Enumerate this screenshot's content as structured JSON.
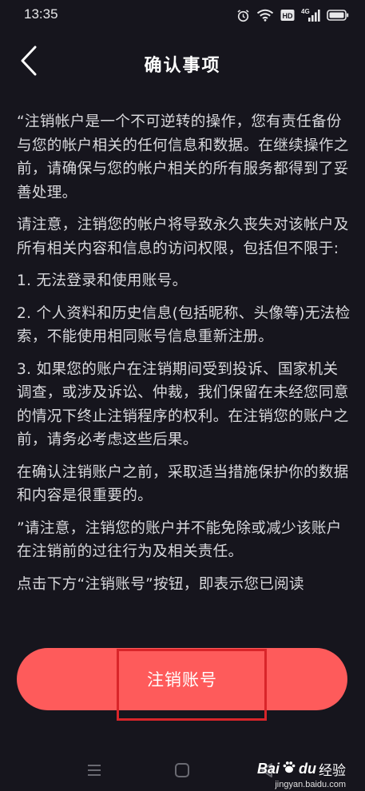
{
  "status_bar": {
    "time": "13:35",
    "icons": [
      "alarm-icon",
      "wifi-icon",
      "hd-icon",
      "signal-4g-icon",
      "battery-icon"
    ],
    "hd_label": "HD",
    "network_label": "4G"
  },
  "header": {
    "title": "确认事项",
    "back_icon": "chevron-left-icon"
  },
  "content": {
    "paragraphs": [
      "“注销帐户是一个不可逆转的操作，您有责任备份与您的帐户相关的任何信息和数据。在继续操作之前，请确保与您的帐户相关的所有服务都得到了妥善处理。",
      "请注意，注销您的帐户将导致永久丧失对该帐户及所有相关内容和信息的访问权限，包括但不限于:",
      "1. 无法登录和使用账号。",
      "2. 个人资料和历史信息(包括昵称、头像等)无法检索，不能使用相同账号信息重新注册。",
      "3. 如果您的账户在注销期间受到投诉、国家机关调查，或涉及诉讼、仲裁，我们保留在未经您同意的情况下终止注销程序的权利。在注销您的账户之前，请务必考虑这些后果。",
      "在确认注销账户之前，采取适当措施保护你的数据和内容是很重要的。",
      "”请注意，注销您的账户并不能免除或减少该账户在注销前的过往行为及相关责任。",
      "点击下方“注销账号”按钮，即表示您已阅读"
    ]
  },
  "action": {
    "button_label": "注销账号",
    "button_color": "#fe5b5b",
    "highlight_color": "#d9252a"
  },
  "system_nav": {
    "icons": [
      "menu-icon",
      "home-icon",
      "back-triangle-icon"
    ]
  },
  "watermark": {
    "brand": "Bai",
    "brand_suffix": "du",
    "label": "经验",
    "url": "jingyan.baidu.com"
  }
}
